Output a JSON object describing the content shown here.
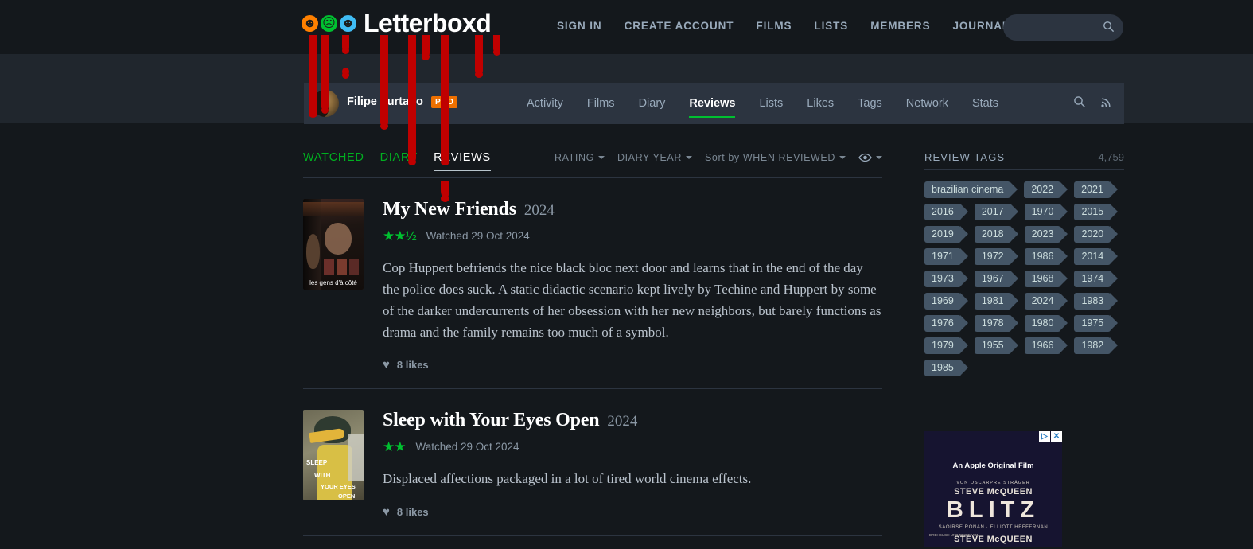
{
  "site": {
    "logo_text": "Letterboxd",
    "logo_dots": [
      "pumpkin-icon",
      "ghostface-icon",
      "hockey-mask-icon"
    ],
    "nav": [
      {
        "label": "SIGN IN",
        "name": "sign-in"
      },
      {
        "label": "CREATE ACCOUNT",
        "name": "create-account"
      },
      {
        "label": "FILMS",
        "name": "films"
      },
      {
        "label": "LISTS",
        "name": "lists"
      },
      {
        "label": "MEMBERS",
        "name": "members"
      },
      {
        "label": "JOURNAL",
        "name": "journal"
      }
    ],
    "search": {
      "placeholder": "",
      "value": "",
      "icon": "search-icon"
    }
  },
  "profile": {
    "name": "Filipe Furtado",
    "badge": "PRO",
    "tabs": [
      {
        "label": "Activity",
        "active": false
      },
      {
        "label": "Films",
        "active": false
      },
      {
        "label": "Diary",
        "active": false
      },
      {
        "label": "Reviews",
        "active": true
      },
      {
        "label": "Lists",
        "active": false
      },
      {
        "label": "Likes",
        "active": false
      },
      {
        "label": "Tags",
        "active": false
      },
      {
        "label": "Network",
        "active": false
      },
      {
        "label": "Stats",
        "active": false
      }
    ],
    "icons": [
      "search-icon",
      "rss-icon"
    ]
  },
  "filters": {
    "tabs": [
      {
        "label": "WATCHED",
        "active": false
      },
      {
        "label": "DIARY",
        "active": false
      },
      {
        "label": "REVIEWS",
        "active": true
      }
    ],
    "controls": [
      {
        "label": "RATING",
        "name": "rating-filter"
      },
      {
        "label": "DIARY YEAR",
        "name": "diary-year-filter"
      },
      {
        "label": "Sort by WHEN REVIEWED",
        "name": "sort-by-filter"
      }
    ],
    "visibility_icon": "eye-icon"
  },
  "reviews": [
    {
      "title": "My New Friends",
      "year": "2024",
      "stars": "★★½",
      "watched": "Watched 29 Oct 2024",
      "text": "Cop Huppert befriends the nice black bloc next door and learns that in the end of the day the police does suck. A static didactic scenario kept lively by Techine and Huppert by some of the darker undercurrents of her obsession with her new neighbors, but barely functions as drama and the family remains too much of a symbol.",
      "likes": "8 likes",
      "poster_caption": "les gens d'à côté"
    },
    {
      "title": "Sleep with Your Eyes Open",
      "year": "2024",
      "stars": "★★",
      "watched": "Watched 29 Oct 2024",
      "text": "Displaced affections packaged in a lot of tired world cinema effects.",
      "likes": "8 likes",
      "poster_caption": "SLEEP WITH YOUR EYES OPEN"
    }
  ],
  "sidebar": {
    "tags_title": "REVIEW TAGS",
    "tags_count": "4,759",
    "tags": [
      "brazilian cinema",
      "2022",
      "2021",
      "2016",
      "2017",
      "1970",
      "2015",
      "2019",
      "2018",
      "2023",
      "2020",
      "1971",
      "1972",
      "1986",
      "2014",
      "1973",
      "1967",
      "1968",
      "1974",
      "1969",
      "1981",
      "2024",
      "1983",
      "1976",
      "1978",
      "1980",
      "1975",
      "1979",
      "1955",
      "1966",
      "1982",
      "1985"
    ]
  },
  "ad": {
    "line1": "An Apple Original Film",
    "line2": "VON OSCARPREISTRÄGER",
    "line3": "STEVE McQUEEN",
    "title": "BLITZ",
    "cast": "SAOIRSE RONAN · ELLIOTT HEFFERNAN",
    "credit_small": "DREHBUCH UND REGIE VON",
    "credit": "STEVE McQUEEN",
    "adchoices": [
      "▷",
      "✕"
    ]
  },
  "colors": {
    "background": "#14181c",
    "panel": "#2c3440",
    "accent_green": "#00c030",
    "accent_orange": "#ee7000",
    "blood": "#c00000",
    "text_muted": "#9ab"
  }
}
